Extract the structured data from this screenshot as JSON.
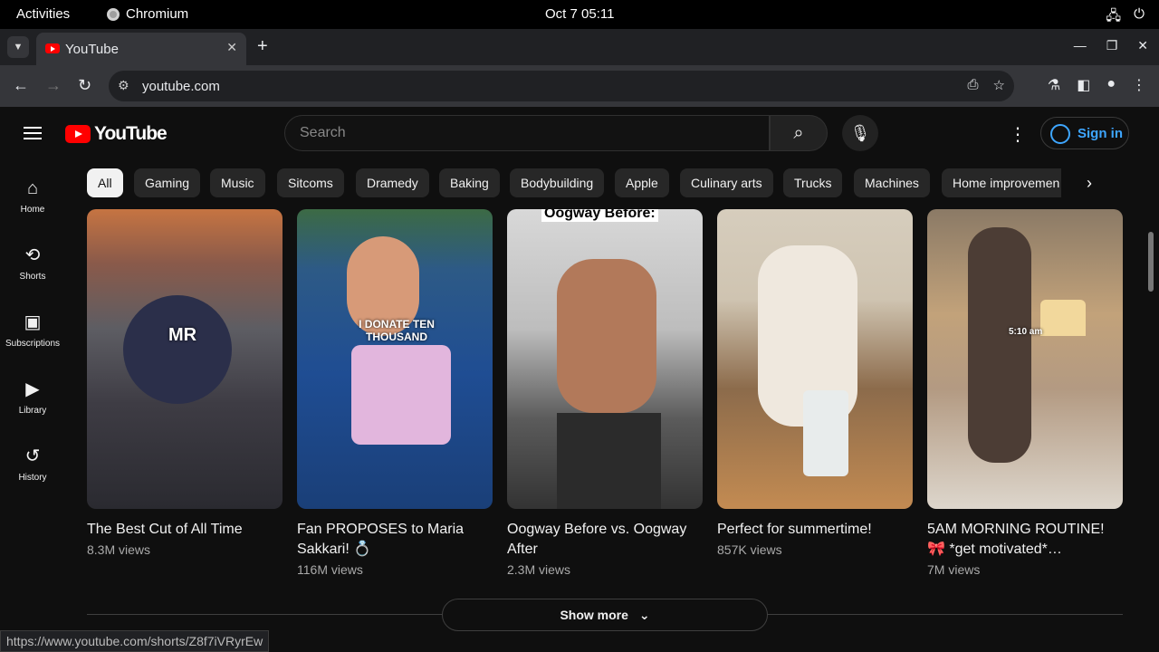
{
  "gnome": {
    "activities": "Activities",
    "app": "Chromium",
    "clock": "Oct 7  05:11"
  },
  "browser": {
    "tab_title": "YouTube",
    "url": "youtube.com",
    "status_url": "https://www.youtube.com/shorts/Z8f7iVRyrEw"
  },
  "youtube": {
    "logo_text": "YouTube",
    "search_placeholder": "Search",
    "sign_in": "Sign in",
    "guide": [
      {
        "label": "Home",
        "icon": "home-icon"
      },
      {
        "label": "Shorts",
        "icon": "shorts-icon"
      },
      {
        "label": "Subscriptions",
        "icon": "subscriptions-icon"
      },
      {
        "label": "Library",
        "icon": "library-icon"
      },
      {
        "label": "History",
        "icon": "history-icon"
      }
    ],
    "chips": [
      "All",
      "Gaming",
      "Music",
      "Sitcoms",
      "Dramedy",
      "Baking",
      "Bodybuilding",
      "Apple",
      "Culinary arts",
      "Trucks",
      "Machines",
      "Home improvemen"
    ],
    "shorts": [
      {
        "title": "The Best Cut of All Time",
        "views": "8.3M views",
        "overlay": "MR"
      },
      {
        "title": "Fan PROPOSES to Maria Sakkari! 💍",
        "views": "116M views",
        "overlay": "I DONATE TEN THOUSAND"
      },
      {
        "title": "Oogway Before vs. Oogway After",
        "views": "2.3M views",
        "overlay": "Oogway Before:"
      },
      {
        "title": "Perfect for summertime!",
        "views": "857K views",
        "overlay": ""
      },
      {
        "title": "5AM MORNING ROUTINE! 🎀 *get motivated*…",
        "views": "7M views",
        "overlay": "5:10 am"
      }
    ],
    "show_more": "Show more"
  }
}
